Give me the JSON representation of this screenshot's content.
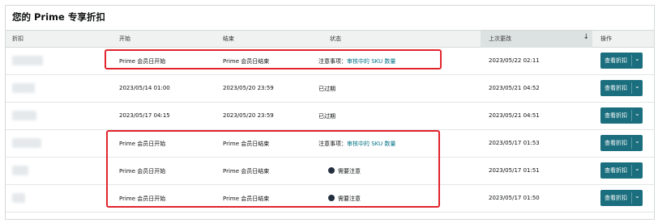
{
  "title": "您的 Prime 专享折扣",
  "columns": {
    "discount": "折扣",
    "start": "开始",
    "end": "结束",
    "status": "状态",
    "last_updated": "上次更改",
    "actions": "操作"
  },
  "sort_icon": "down-arrow-icon",
  "rows": [
    {
      "start": "Prime 会员日开始",
      "end": "Prime 会员日结束",
      "status_prefix": "注意事项：",
      "status_link": "审核中的 SKU 数量",
      "status_text": "",
      "updated": "2023/05/22 02:11",
      "button": "查看折扣"
    },
    {
      "start": "2023/05/14 01:00",
      "end": "2023/05/20 23:59",
      "status_prefix": "",
      "status_link": "",
      "status_text": "已过期",
      "updated": "2023/05/21 04:52",
      "button": "查看折扣"
    },
    {
      "start": "2023/05/17 04:15",
      "end": "2023/05/20 23:59",
      "status_prefix": "",
      "status_link": "",
      "status_text": "已过期",
      "updated": "2023/05/21 04:51",
      "button": "查看折扣"
    },
    {
      "start": "Prime 会员日开始",
      "end": "Prime 会员日结束",
      "status_prefix": "注意事项：",
      "status_link": "审核中的 SKU 数量",
      "status_text": "",
      "updated": "2023/05/17 01:53",
      "button": "查看折扣"
    },
    {
      "start": "Prime 会员日开始",
      "end": "Prime 会员日结束",
      "status_prefix": "",
      "status_link": "",
      "status_text": "需要注意",
      "updated": "2023/05/17 01:51",
      "button": "查看折扣"
    },
    {
      "start": "Prime 会员日开始",
      "end": "Prime 会员日结束",
      "status_prefix": "",
      "status_link": "",
      "status_text": "需要注意",
      "updated": "2023/05/17 01:50",
      "button": "查看折扣"
    }
  ],
  "colors": {
    "accent": "#1b6e7d",
    "link": "#007185",
    "callout": "#e1242c"
  }
}
